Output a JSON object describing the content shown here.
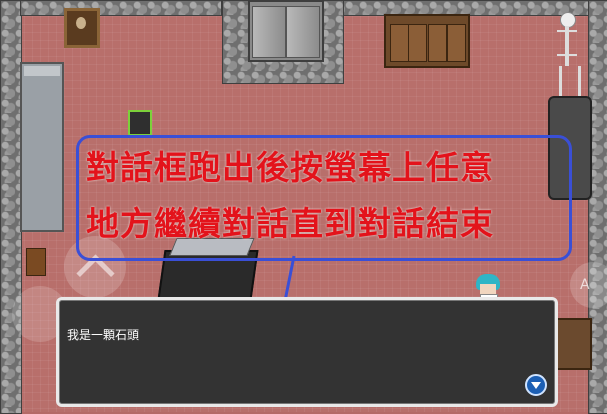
{
  "annotation": {
    "line1": "對話框跑出後按螢幕上任意",
    "line2": "地方繼續對話直到對話結束",
    "color": "#e3131b",
    "border_color": "#3a4fd6"
  },
  "dialog": {
    "text": "我是一顆石頭",
    "next_icon": "chevron-down-icon"
  },
  "controls": {
    "a_button": "A",
    "dpad_icon": "chevron-up-icon"
  }
}
